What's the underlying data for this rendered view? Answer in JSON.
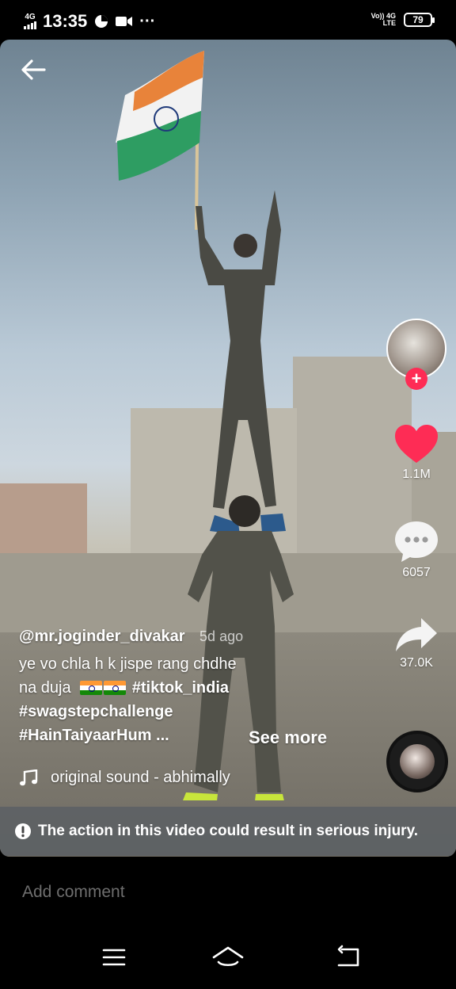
{
  "status_bar": {
    "network_left": "4G",
    "time": "13:35",
    "network_right_top": "Vo)) 4G",
    "network_right_bottom": "LTE",
    "battery": "79"
  },
  "video": {
    "username": "@mr.joginder_divakar",
    "time_ago": "5d ago",
    "caption_line1": "ye vo chla h k jispe rang chdhe",
    "caption_line2_text": "na duja",
    "hashtag1": "#tiktok_india",
    "hashtag2": "#swagstepchallenge",
    "hashtag3": "#HainTaiyaarHum ...",
    "see_more": "See more",
    "sound": "original sound - abhimally",
    "warning": "The action in this video could result in serious injury."
  },
  "actions": {
    "likes": "1.1M",
    "comments": "6057",
    "shares": "37.0K"
  },
  "comment": {
    "placeholder": "Add comment"
  },
  "colors": {
    "like": "#fe2c55",
    "follow": "#fe2c55"
  }
}
